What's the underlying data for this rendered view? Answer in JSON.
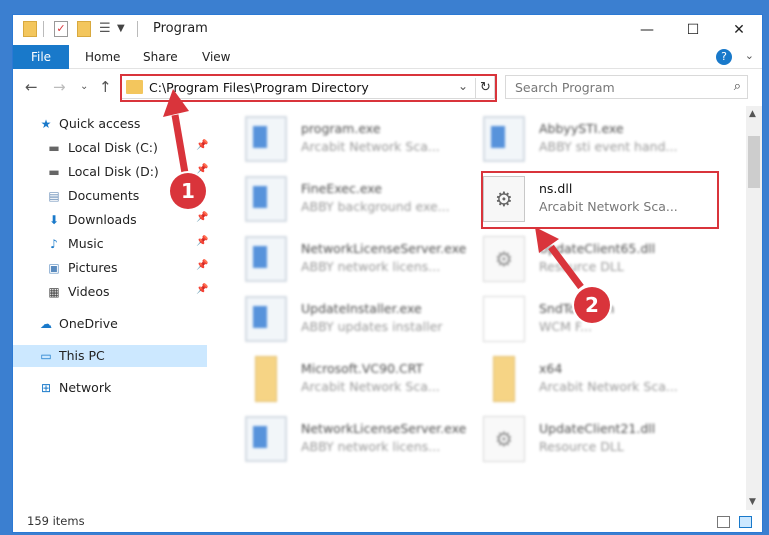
{
  "window": {
    "title": "Program",
    "minimize": "—",
    "maximize": "☐",
    "close": "✕"
  },
  "ribbon": {
    "tabs": [
      "File",
      "Home",
      "Share",
      "View"
    ],
    "help": "?"
  },
  "address": {
    "path": "C:\\Program Files\\Program Directory"
  },
  "search": {
    "placeholder": "Search Program"
  },
  "nav": [
    {
      "label": "Quick access",
      "icon": "star-icon",
      "pinned": false
    },
    {
      "label": "Local Disk (C:)",
      "icon": "drive-icon",
      "pinned": true
    },
    {
      "label": "Local Disk (D:)",
      "icon": "drive-icon",
      "pinned": true
    },
    {
      "label": "Documents",
      "icon": "documents-icon",
      "pinned": true
    },
    {
      "label": "Downloads",
      "icon": "download-icon",
      "pinned": true
    },
    {
      "label": "Music",
      "icon": "music-icon",
      "pinned": true
    },
    {
      "label": "Pictures",
      "icon": "pictures-icon",
      "pinned": true
    },
    {
      "label": "Videos",
      "icon": "videos-icon",
      "pinned": true
    },
    {
      "label": "OneDrive",
      "icon": "cloud-icon",
      "pinned": false
    },
    {
      "label": "This PC",
      "icon": "computer-icon",
      "pinned": false,
      "selected": true
    },
    {
      "label": "Network",
      "icon": "network-icon",
      "pinned": false
    }
  ],
  "files": [
    {
      "name": "program.exe",
      "desc": "Arcabit Network Sca...",
      "icon": "exe-icon"
    },
    {
      "name": "AbbyySTI.exe",
      "desc": "ABBY sti event hand...",
      "icon": "exe-icon"
    },
    {
      "name": "FineExec.exe",
      "desc": "ABBY background exe...",
      "icon": "exe-icon"
    },
    {
      "name": "ns.dll",
      "desc": "Arcabit Network Sca...",
      "icon": "dll-icon",
      "highlighted": true
    },
    {
      "name": "NetworkLicenseServer.exe",
      "desc": "ABBY network licens...",
      "icon": "exe-icon"
    },
    {
      "name": "UpdateClient65.dll",
      "desc": "Resource DLL",
      "icon": "dll-icon"
    },
    {
      "name": "UpdateInstaller.exe",
      "desc": "ABBY updates installer",
      "icon": "exe-icon"
    },
    {
      "name": "SndTo...ocm",
      "desc": "WCM F...",
      "icon": "doc-icon"
    },
    {
      "name": "Microsoft.VC90.CRT",
      "desc": "Arcabit Network Sca...",
      "icon": "folder-icon"
    },
    {
      "name": "x64",
      "desc": "Arcabit Network Sca...",
      "icon": "folder-icon"
    },
    {
      "name": "NetworkLicenseServer.exe",
      "desc": "ABBY network licens...",
      "icon": "exe-icon"
    },
    {
      "name": "UpdateClient21.dll",
      "desc": "Resource DLL",
      "icon": "dll-icon"
    }
  ],
  "status": {
    "item_count": "159 items"
  },
  "annotations": {
    "step1": "1",
    "step2": "2"
  },
  "colors": {
    "accent": "#1979ca",
    "highlight": "#d9343b",
    "selected": "#cce8ff"
  }
}
